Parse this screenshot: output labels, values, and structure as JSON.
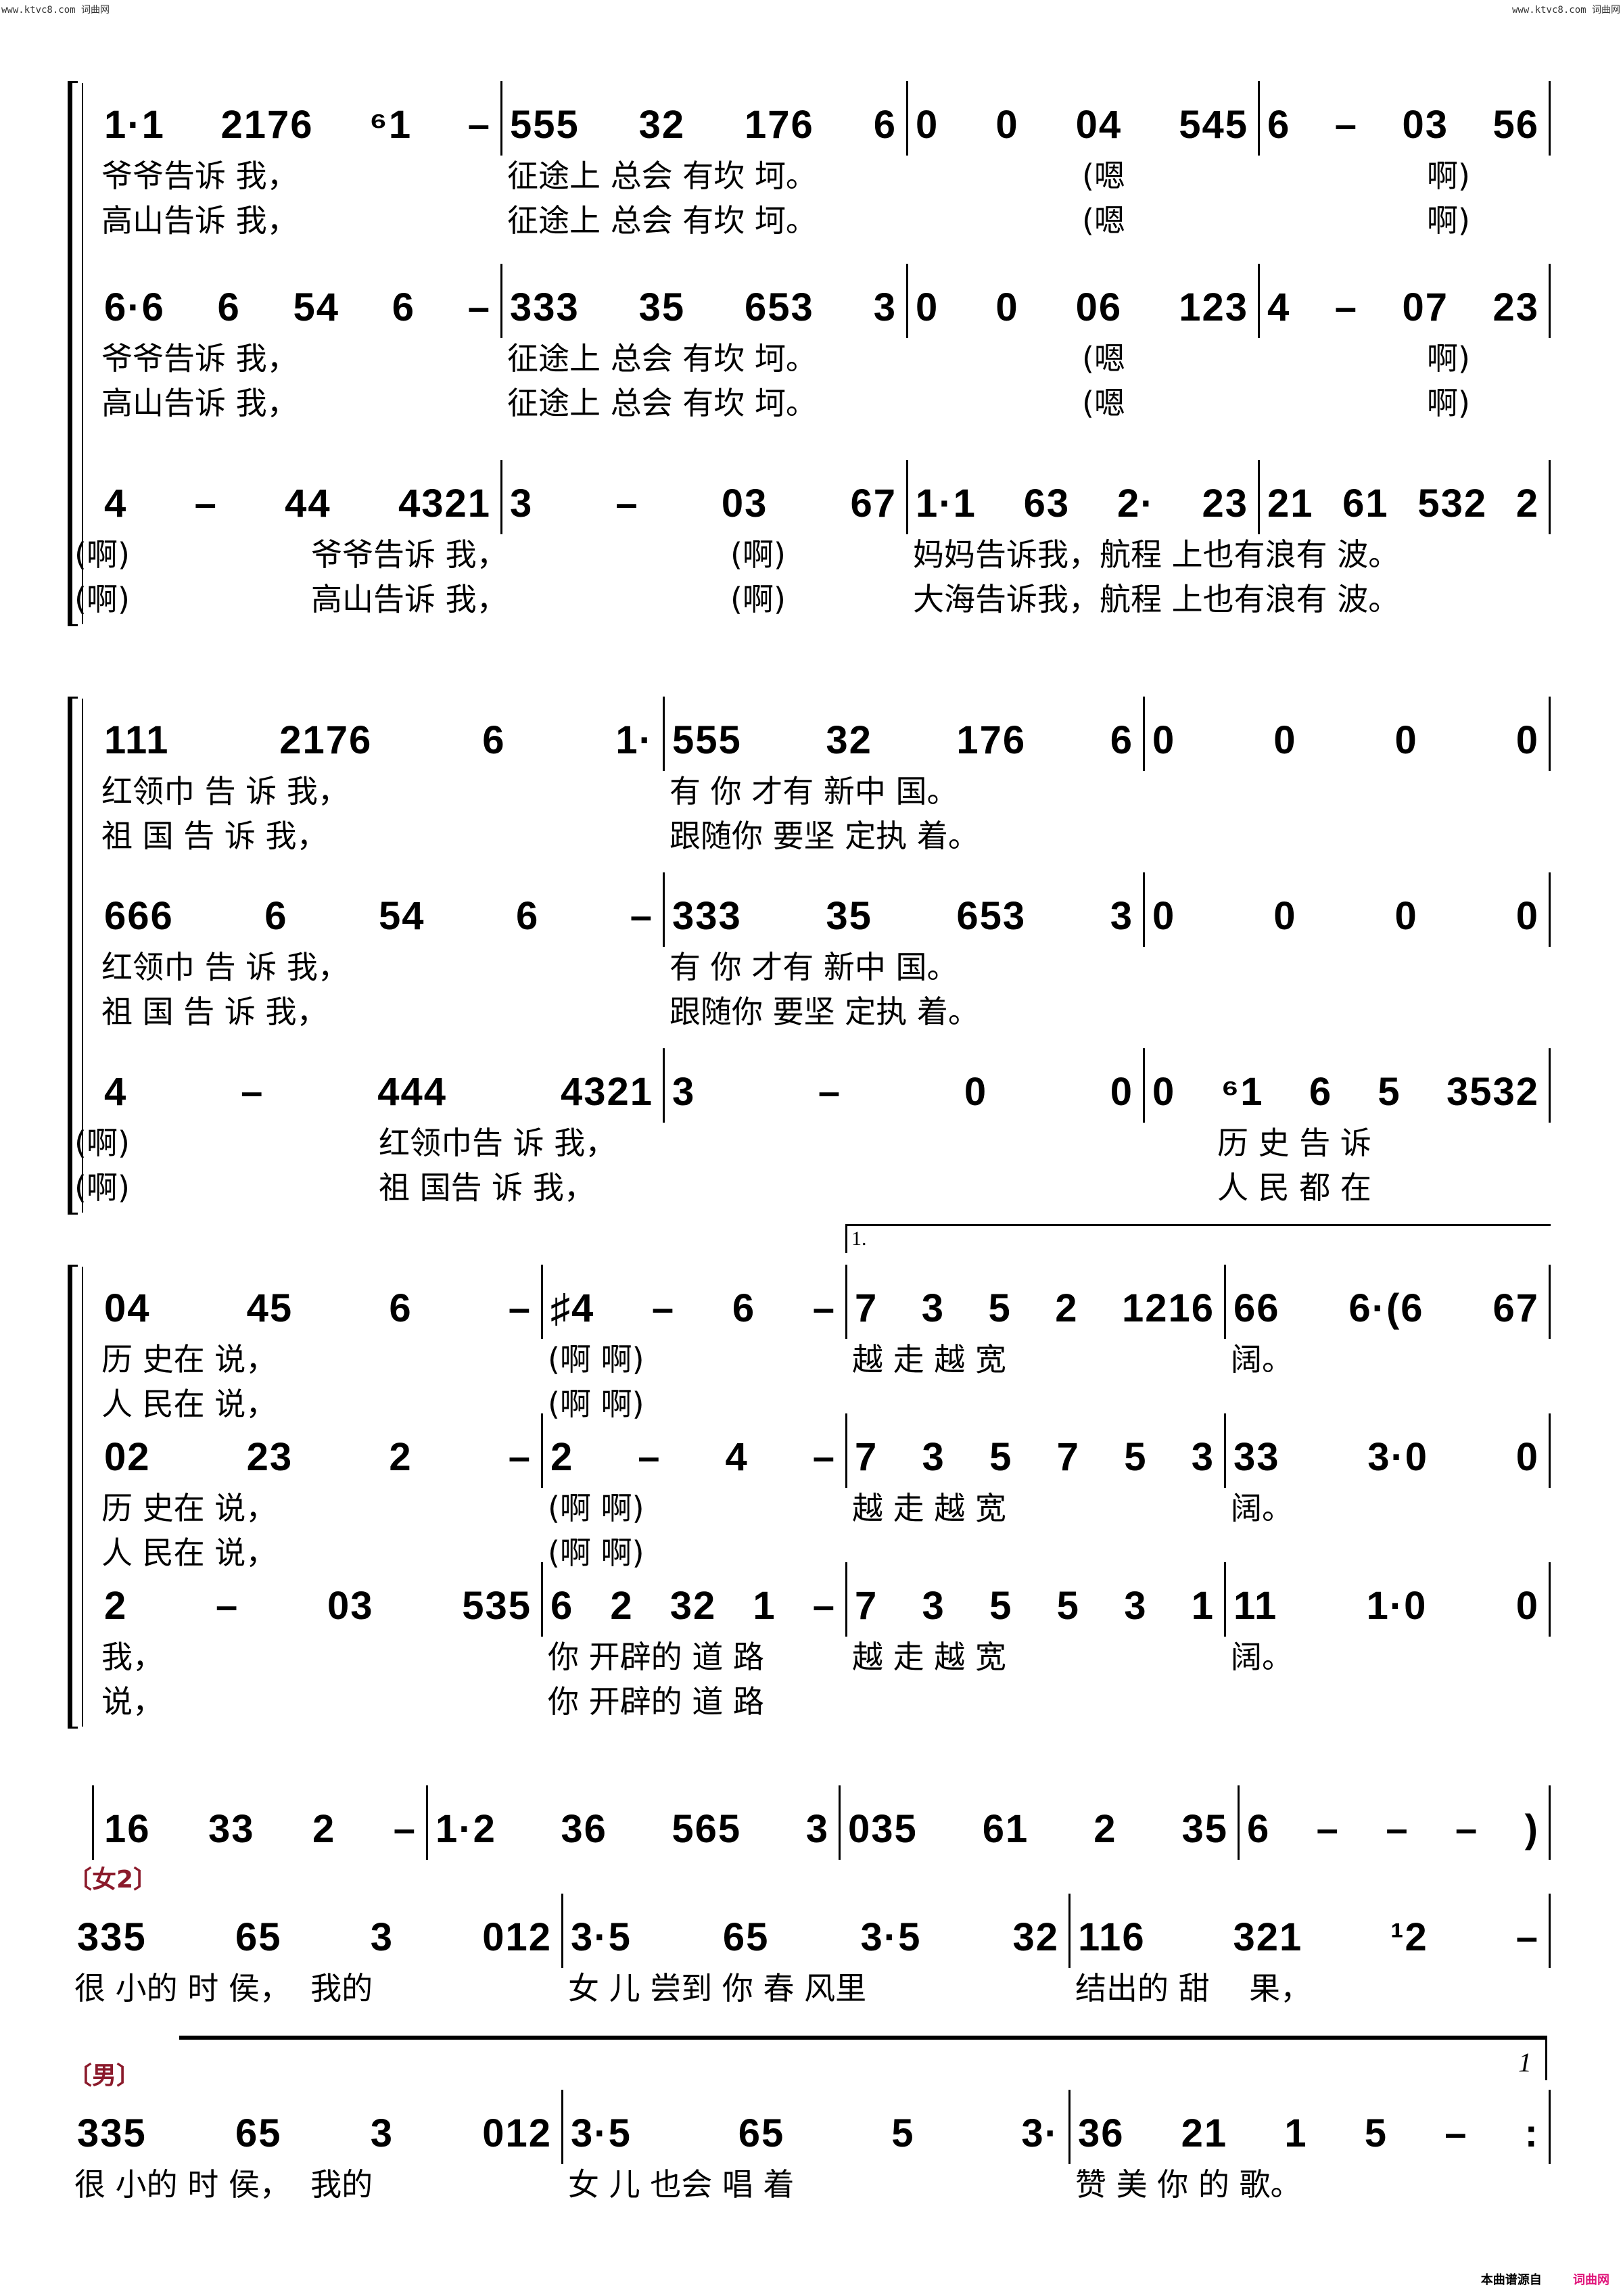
{
  "watermark": {
    "left": "www.ktvc8.com 词曲网",
    "right": "www.ktvc8.com 词曲网"
  },
  "footer": {
    "source_label": "本曲谱源自",
    "brand": "词曲网"
  },
  "systems": [
    {
      "rows": [
        {
          "measures": [
            "1·1 2176 ⁶1 –",
            "555 32 176 6",
            "0 0 04 545",
            "6 – 03 56"
          ],
          "lyrics": [
            [
              "爷爷告诉 我，",
              "征途上 总会 有坎 坷。",
              "(嗯",
              "啊)"
            ],
            [
              "高山告诉 我，",
              "征途上 总会 有坎 坷。",
              "(嗯",
              "啊)"
            ]
          ]
        },
        {
          "measures": [
            "6·6 6 54 6 –",
            "333 35 653 3",
            "0 0 06 123",
            "4 – 07 23"
          ],
          "lyrics": [
            [
              "爷爷告诉 我，",
              "征途上 总会 有坎 坷。",
              "(嗯",
              "啊)"
            ],
            [
              "高山告诉 我，",
              "征途上 总会 有坎 坷。",
              "(嗯",
              "啊)"
            ]
          ]
        },
        {
          "measures": [
            "4 – 44 4321",
            "3 – 03 67",
            "1·1 63 2· 23",
            "21 61 532 2"
          ],
          "lyrics": [
            [
              "(啊)",
              "爷爷告诉 我，",
              "(啊)",
              "妈妈告诉我，航程 上也有浪有 波。"
            ],
            [
              "(啊)",
              "高山告诉 我，",
              "(啊)",
              "大海告诉我，航程 上也有浪有 波。"
            ]
          ]
        }
      ]
    },
    {
      "rows": [
        {
          "measures": [
            "111 2176 6 1·",
            "555 32 176 6",
            "0 0 0 0"
          ],
          "lyrics": [
            [
              "红领巾 告 诉 我，",
              "有 你 才有 新中 国。"
            ],
            [
              "祖 国 告 诉 我，",
              "跟随你 要坚 定执 着。"
            ]
          ]
        },
        {
          "measures": [
            "666 6 54 6 –",
            "333 35 653 3",
            "0 0 0 0"
          ],
          "lyrics": [
            [
              "红领巾 告 诉 我，",
              "有 你 才有 新中 国。"
            ],
            [
              "祖 国 告 诉 我，",
              "跟随你 要坚 定执 着。"
            ]
          ]
        },
        {
          "measures": [
            "4 – 444 4321",
            "3 – 0 0",
            "0 ⁶1 6 5 3532"
          ],
          "lyrics": [
            [
              "(啊)",
              "红领巾告 诉 我，",
              "历 史 告 诉"
            ],
            [
              "(啊)",
              "祖 国告 诉 我，",
              "人 民 都 在"
            ]
          ]
        }
      ]
    },
    {
      "volta_label": "1.",
      "rows": [
        {
          "measures": [
            "04 45 6 –",
            "♯4 – 6 –",
            "7 3 5 2 1216",
            "66 6·(6 67"
          ],
          "lyrics": [
            [
              "历 史在 说，",
              "(啊 啊)",
              "越 走 越 宽",
              "阔。"
            ],
            [
              "人 民在 说，",
              "(啊 啊)",
              "",
              ""
            ]
          ]
        },
        {
          "measures": [
            "02 23 2 –",
            "2 – 4 –",
            "7 3 5 7 5 3",
            "33 3·0 0"
          ],
          "lyrics": [
            [
              "历 史在 说，",
              "(啊 啊)",
              "越 走 越 宽",
              "阔。"
            ],
            [
              "人 民在 说，",
              "(啊 啊)",
              "",
              ""
            ]
          ]
        },
        {
          "measures": [
            "2 – 03 535",
            "6 2 32 1 –",
            "7 3 5 5 3 1",
            "11 1·0 0"
          ],
          "lyrics": [
            [
              "我，",
              "你 开辟的 道 路",
              "越 走 越 宽",
              "阔。"
            ],
            [
              "说，",
              "你 开辟的 道 路",
              "",
              ""
            ]
          ]
        }
      ]
    },
    {
      "rows": [
        {
          "measures": [
            "16 33 2 –",
            "1·2 36 565 3",
            "035 61 2 35",
            "6 – – – )"
          ],
          "lyrics": []
        }
      ]
    },
    {
      "part_label": "〔女2〕",
      "rows": [
        {
          "measures": [
            "335 65 3 012",
            "3·5 65 3·5 32",
            "116 321 ¹2 –"
          ],
          "lyrics": [
            [
              "很 小的 时 侯，  我的",
              "女 儿 尝到 你 春 风里",
              "结出的 甜    果，"
            ]
          ]
        }
      ]
    },
    {
      "part_label": "〔男〕",
      "volta_end_label": "1",
      "rows": [
        {
          "measures": [
            "335 65 3 012",
            "3·5 65 5 3·",
            "36 21 1 5 – :"
          ],
          "lyrics": [
            [
              "很 小的 时 侯，  我的",
              "女 儿 也会 唱 着",
              "赞 美 你 的 歌。"
            ]
          ]
        }
      ]
    }
  ]
}
